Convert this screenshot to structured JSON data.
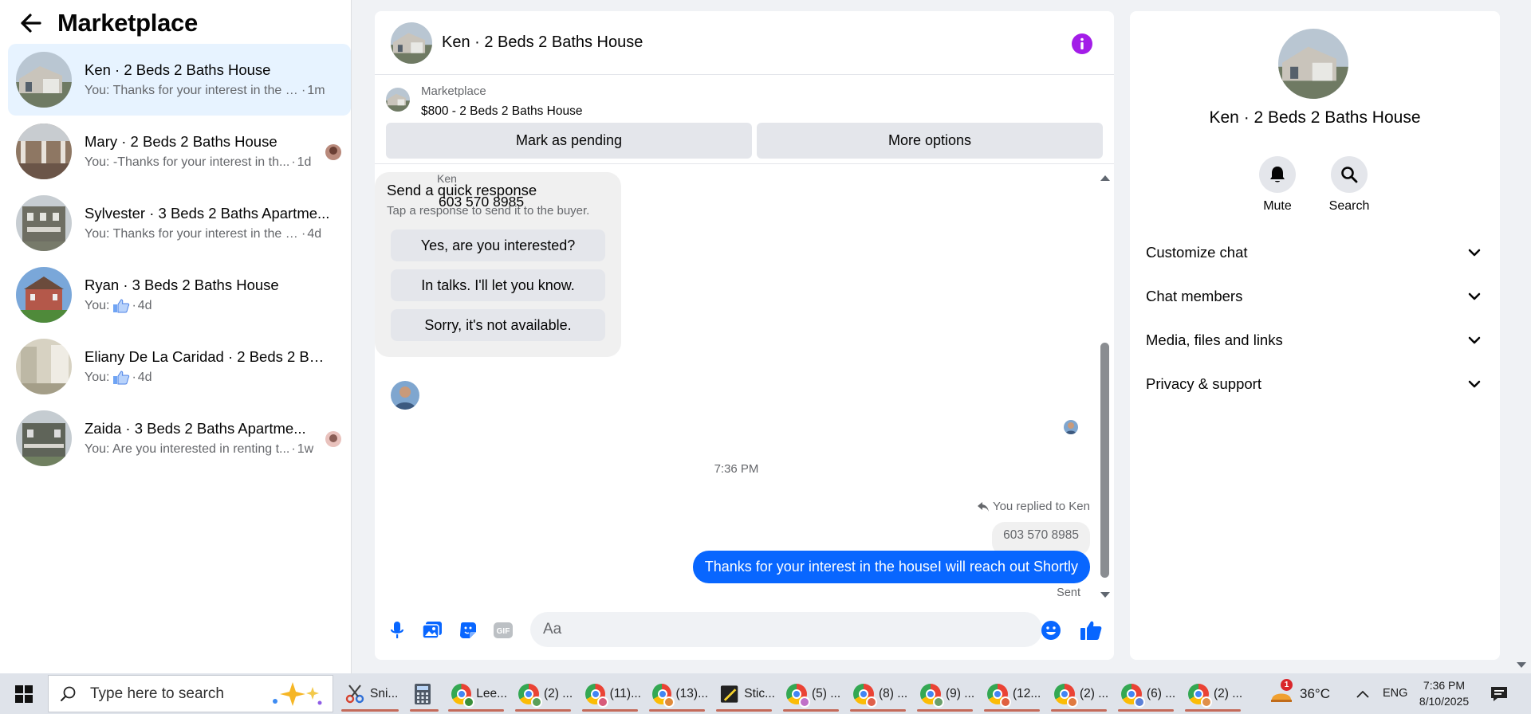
{
  "sidebar": {
    "title": "Marketplace",
    "conversations": [
      {
        "name": "Ken · 2 Beds 2 Baths House",
        "preview": "You: Thanks for your interest in the h...",
        "time": "1m",
        "active": true
      },
      {
        "name": "Mary · 2 Beds 2 Baths House",
        "preview": "You: -Thanks for your interest in th...",
        "time": "1d"
      },
      {
        "name": "Sylvester · 3 Beds 2 Baths Apartme...",
        "preview": "You: Thanks for your interest in the ho...",
        "time": "4d"
      },
      {
        "name": "Ryan · 3 Beds 2 Baths House",
        "preview": "You:",
        "time": "4d"
      },
      {
        "name": "Eliany De La Caridad · 2 Beds 2 Bat...",
        "preview": "You:",
        "time": "4d"
      },
      {
        "name": "Zaida · 3 Beds 2 Baths Apartme...",
        "preview": "You: Are you interested in renting t...",
        "time": "1w"
      }
    ]
  },
  "chat": {
    "title": "Ken · 2 Beds 2 Baths House",
    "listing": {
      "source": "Marketplace",
      "price_title": "$800 - 2 Beds 2 Baths House"
    },
    "actions": {
      "pending": "Mark as pending",
      "more": "More options"
    },
    "messages": {
      "sender": "Ken",
      "phone": "603 570 8985",
      "quick_title": "Send a quick response",
      "quick_sub": "Tap a response to send it to the buyer.",
      "quick_options": [
        "Yes, are you interested?",
        "In talks. I'll let you know.",
        "Sorry, it's not available."
      ],
      "timestamp": "7:36 PM",
      "replied_label": "You replied to Ken",
      "replied_quote": "603 570 8985",
      "outgoing": "Thanks for your interest in the houseI will reach out Shortly",
      "status": "Sent"
    },
    "composer": {
      "placeholder": "Aa",
      "gif": "GIF"
    }
  },
  "right_panel": {
    "name": "Ken · 2 Beds 2 Baths House",
    "mute": "Mute",
    "search": "Search",
    "sections": [
      "Customize chat",
      "Chat members",
      "Media, files and links",
      "Privacy & support"
    ]
  },
  "taskbar": {
    "search_placeholder": "Type here to search",
    "apps": [
      {
        "label": "Sni...",
        "icon": "snipping-tool-icon"
      },
      {
        "label": "",
        "icon": "calculator-icon"
      },
      {
        "label": "Lee...",
        "icon": "chrome-icon"
      },
      {
        "label": "(2) ...",
        "icon": "chrome-icon"
      },
      {
        "label": "(11)...",
        "icon": "chrome-icon"
      },
      {
        "label": "(13)...",
        "icon": "chrome-icon"
      },
      {
        "label": "Stic...",
        "icon": "sticky-notes-icon"
      },
      {
        "label": "(5) ...",
        "icon": "chrome-icon"
      },
      {
        "label": "(8) ...",
        "icon": "chrome-icon"
      },
      {
        "label": "(9) ...",
        "icon": "chrome-icon"
      },
      {
        "label": "(12...",
        "icon": "chrome-icon"
      },
      {
        "label": "(2) ...",
        "icon": "chrome-icon"
      },
      {
        "label": "(6) ...",
        "icon": "chrome-icon"
      },
      {
        "label": "(2) ...",
        "icon": "chrome-icon"
      }
    ],
    "weather_badge": "1",
    "temperature": "36°C",
    "language": "ENG",
    "time": "7:36 PM",
    "date": "8/10/2025"
  },
  "colors": {
    "accent": "#0866ff",
    "info": "#a31de8",
    "active_row": "#e7f3ff"
  }
}
